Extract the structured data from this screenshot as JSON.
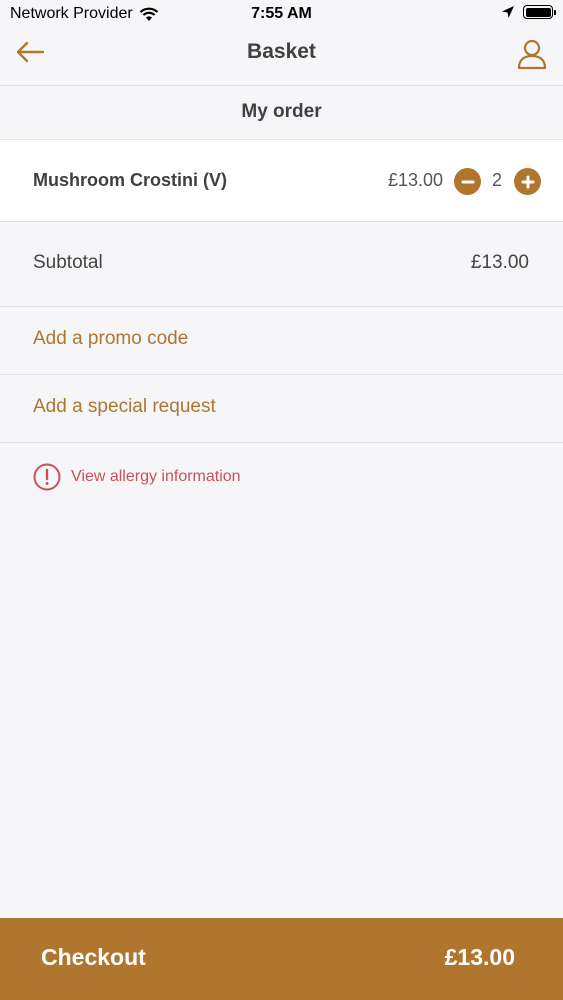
{
  "status_bar": {
    "carrier": "Network Provider",
    "time": "7:55 AM"
  },
  "nav": {
    "title": "Basket",
    "back_icon": "arrow-left-icon",
    "profile_icon": "user-icon"
  },
  "section": {
    "title": "My order"
  },
  "order": {
    "items": [
      {
        "name": "Mushroom Crostini (V)",
        "price": "£13.00",
        "quantity": "2"
      }
    ]
  },
  "summary": {
    "subtotal_label": "Subtotal",
    "subtotal_value": "£13.00",
    "promo_label": "Add a promo code",
    "request_label": "Add a special request"
  },
  "allergy": {
    "label": "View allergy information",
    "icon": "alert-circle-icon"
  },
  "checkout": {
    "label": "Checkout",
    "total": "£13.00"
  },
  "colors": {
    "accent": "#b0762e",
    "link": "#ad772f",
    "allergy": "#c9525a",
    "background": "#f6f5f8"
  }
}
